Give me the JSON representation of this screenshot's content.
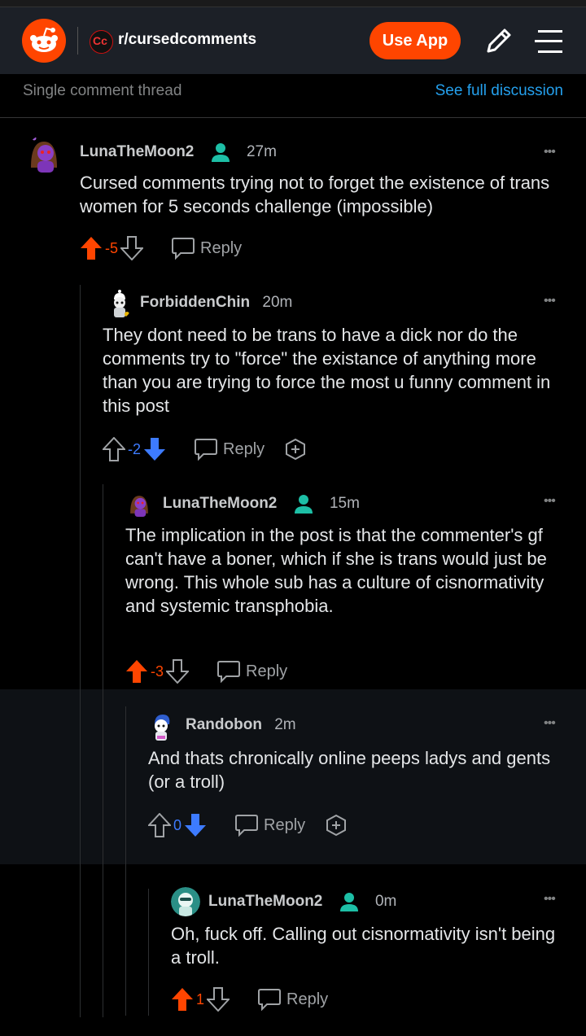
{
  "header": {
    "subreddit": "r/cursedcomments",
    "use_app_label": "Use App",
    "brand_color": "#ff4500"
  },
  "subbar": {
    "left": "Single comment thread",
    "right": "See full discussion"
  },
  "actions": {
    "reply_label": "Reply"
  },
  "comments": [
    {
      "author": "LunaTheMoon2",
      "time": "27m",
      "has_flair": true,
      "text": "Cursed comments trying not to forget the existence of trans women for 5 seconds challenge (impossible)",
      "score": "-5",
      "vote": "up",
      "more": "•••"
    },
    {
      "author": "ForbiddenChin",
      "time": "20m",
      "has_flair": false,
      "text": "They dont need to be trans to have a dick nor do the comments try to \"force\" the existance of anything more than you are trying to force the most u funny comment in this post",
      "score": "-2",
      "vote": "down",
      "more": "•••"
    },
    {
      "author": "LunaTheMoon2",
      "time": "15m",
      "has_flair": true,
      "text": "The implication in the post is that the commenter's gf can't have a boner, which if she is trans would just be wrong. This whole sub has a culture of cisnormativity and systemic transphobia.",
      "score": "-3",
      "vote": "up",
      "more": "•••"
    },
    {
      "author": "Randobon",
      "time": "2m",
      "has_flair": false,
      "text": "And thats chronically online peeps ladys and gents (or a troll)",
      "score": "0",
      "vote": "down",
      "more": "•••"
    },
    {
      "author": "LunaTheMoon2",
      "time": "0m",
      "has_flair": true,
      "text": "Oh, fuck off. Calling out cisnormativity isn't being a troll.",
      "score": "1",
      "vote": "up",
      "more": "•••"
    }
  ],
  "colors": {
    "upvote": "#ff4500",
    "downvote": "#3d7bff",
    "flair": "#1dbfa6",
    "link": "#24a0ed"
  }
}
